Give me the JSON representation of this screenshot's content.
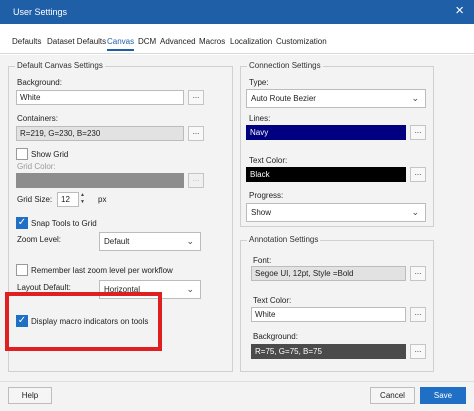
{
  "window": {
    "title": "User Settings",
    "close_icon": "×"
  },
  "tabs": [
    {
      "label": "Defaults"
    },
    {
      "label": "Dataset Defaults"
    },
    {
      "label": "Canvas",
      "active": true
    },
    {
      "label": "DCM"
    },
    {
      "label": "Advanced"
    },
    {
      "label": "Macros"
    },
    {
      "label": "Localization"
    },
    {
      "label": "Customization"
    }
  ],
  "canvas": {
    "legend": "Default Canvas Settings",
    "background_label": "Background:",
    "background_value": "White",
    "containers_label": "Containers:",
    "containers_value": "R=219, G=230, B=230",
    "show_grid_label": "Show Grid",
    "show_grid_checked": false,
    "grid_color_label": "Grid Color:",
    "grid_size_label": "Grid Size:",
    "grid_size_value": "12",
    "grid_size_unit": "px",
    "snap_label": "Snap Tools to Grid",
    "snap_checked": true,
    "zoom_label": "Zoom Level:",
    "zoom_value": "Default",
    "remember_zoom_label": "Remember last zoom level per workflow",
    "remember_zoom_checked": false,
    "layout_label": "Layout Default:",
    "layout_value": "Horizontal",
    "macro_indicators_label": "Display macro indicators on tools",
    "macro_indicators_checked": true,
    "browse_label": "..."
  },
  "connection": {
    "legend": "Connection Settings",
    "type_label": "Type:",
    "type_value": "Auto Route Bezier",
    "lines_label": "Lines:",
    "lines_value": "Navy",
    "lines_color": "#000080",
    "text_color_label": "Text Color:",
    "text_color_value": "Black",
    "text_color_swatch": "#000000",
    "progress_label": "Progress:",
    "progress_value": "Show"
  },
  "annotation": {
    "legend": "Annotation Settings",
    "font_label": "Font:",
    "font_value": "Segoe UI, 12pt, Style =Bold",
    "text_color_label": "Text Color:",
    "text_color_value": "White",
    "background_label": "Background:",
    "background_value": "R=75, G=75, B=75",
    "background_swatch": "#4b4b4b"
  },
  "footer": {
    "help": "Help",
    "cancel": "Cancel",
    "save": "Save"
  },
  "colors": {
    "accent": "#1f6fc4",
    "titlebar": "#1f5fa8",
    "highlight": "#e02020"
  }
}
